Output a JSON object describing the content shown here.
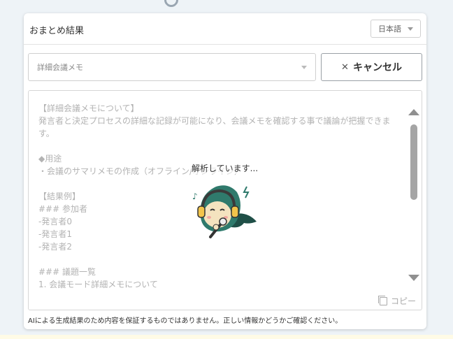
{
  "panel": {
    "title": "おまとめ結果",
    "language": "日本語"
  },
  "controls": {
    "memo_type": "詳細会議メモ",
    "cancel_label": "キャンセル"
  },
  "result": {
    "lines": [
      "【詳細会議メモについて】",
      "発言者と決定プロセスの詳細な記録が可能になり、会議メモを確認する事で議論が把握できます。",
      "",
      "◆用途",
      "・会議のサマリメモの作成（オフライン/オンライン）",
      "",
      "【結果例】",
      "### 参加者",
      "-発言者0",
      "-発言者1",
      "-発言者2",
      "",
      "### 議題一覧",
      "1. 会議モード詳細メモについて"
    ],
    "loading_text": "解析しています...",
    "copy_label": "コピー"
  },
  "footer": {
    "disclaimer": "AIによる生成結果のため内容を保証するものではありません。正しい情報かどうかご確認ください。"
  },
  "icons": {
    "cancel": "close-icon",
    "copy": "copy-icon",
    "mascot": "mascot-icon"
  }
}
